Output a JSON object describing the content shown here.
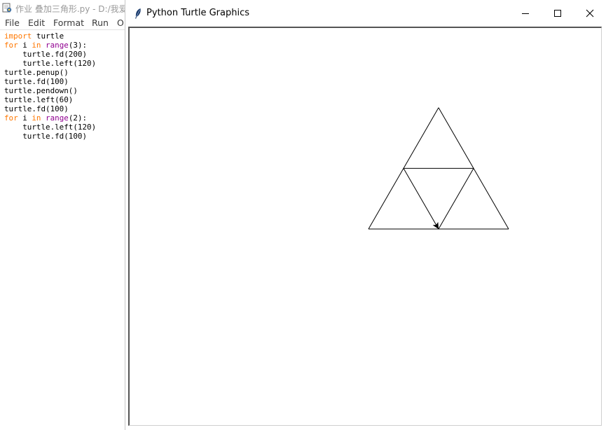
{
  "idle": {
    "title": "作业 叠加三角形.py - D:/我爱",
    "menu": [
      "File",
      "Edit",
      "Format",
      "Run",
      "O"
    ],
    "code": [
      [
        {
          "t": "import",
          "c": "kw"
        },
        {
          "t": " turtle"
        }
      ],
      [
        {
          "t": "for",
          "c": "kw"
        },
        {
          "t": " i "
        },
        {
          "t": "in",
          "c": "kw"
        },
        {
          "t": " "
        },
        {
          "t": "range",
          "c": "bi"
        },
        {
          "t": "(3):"
        }
      ],
      [
        {
          "t": "    turtle.fd(200)"
        }
      ],
      [
        {
          "t": "    turtle.left(120)"
        }
      ],
      [
        {
          "t": "turtle.penup()"
        }
      ],
      [
        {
          "t": "turtle.fd(100)"
        }
      ],
      [
        {
          "t": "turtle.pendown()"
        }
      ],
      [
        {
          "t": "turtle.left(60)"
        }
      ],
      [
        {
          "t": "turtle.fd(100)"
        }
      ],
      [
        {
          "t": "for",
          "c": "kw"
        },
        {
          "t": " i "
        },
        {
          "t": "in",
          "c": "kw"
        },
        {
          "t": " "
        },
        {
          "t": "range",
          "c": "bi"
        },
        {
          "t": "(2):"
        }
      ],
      [
        {
          "t": "    turtle.left(120)"
        }
      ],
      [
        {
          "t": "    turtle.fd(100)"
        }
      ]
    ]
  },
  "turtle_window": {
    "title": "Python Turtle Graphics",
    "controls": {
      "minimize": "minimize-icon",
      "maximize": "maximize-icon",
      "close": "close-icon"
    },
    "drawing": {
      "commands": [
        [
          "fd",
          200
        ],
        [
          "left",
          120
        ],
        [
          "fd",
          200
        ],
        [
          "left",
          120
        ],
        [
          "fd",
          200
        ],
        [
          "left",
          120
        ],
        [
          "penup"
        ],
        [
          "fd",
          100
        ],
        [
          "pendown"
        ],
        [
          "left",
          60
        ],
        [
          "fd",
          100
        ],
        [
          "left",
          120
        ],
        [
          "fd",
          100
        ],
        [
          "left",
          120
        ],
        [
          "fd",
          100
        ]
      ],
      "stroke_color": "#000000",
      "turtle_shape": "classic-arrow"
    }
  },
  "colors": {
    "keyword": "#ff7700",
    "builtin": "#900090"
  }
}
